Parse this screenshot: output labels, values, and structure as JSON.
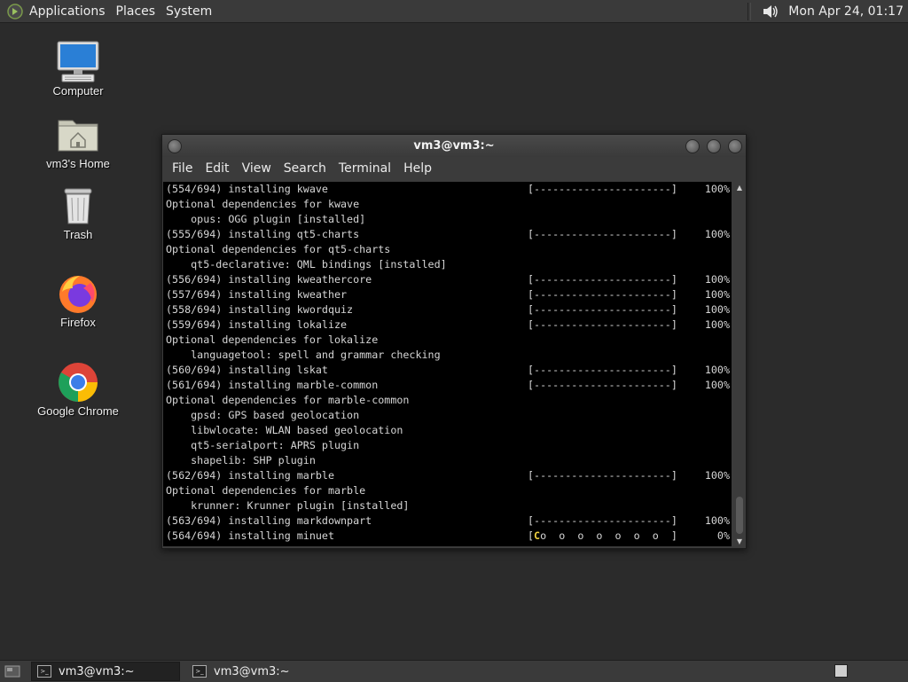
{
  "top_panel": {
    "menus": [
      "Applications",
      "Places",
      "System"
    ],
    "clock": "Mon Apr 24, 01:17"
  },
  "desktop_icons": [
    {
      "label": "Computer",
      "icon": "computer-icon"
    },
    {
      "label": "vm3's Home",
      "icon": "home-folder-icon"
    },
    {
      "label": "Trash",
      "icon": "trash-icon"
    },
    {
      "label": "Firefox",
      "icon": "firefox-icon"
    },
    {
      "label": "Google Chrome",
      "icon": "chrome-icon"
    }
  ],
  "window": {
    "title": "vm3@vm3:~",
    "menu": [
      "File",
      "Edit",
      "View",
      "Search",
      "Terminal",
      "Help"
    ]
  },
  "terminal": {
    "lines": [
      {
        "text": "(554/694) installing kwave",
        "bar": "[----------------------]",
        "pct": "100%"
      },
      {
        "text": "Optional dependencies for kwave"
      },
      {
        "text": "    opus: OGG plugin [installed]"
      },
      {
        "text": "(555/694) installing qt5-charts",
        "bar": "[----------------------]",
        "pct": "100%"
      },
      {
        "text": "Optional dependencies for qt5-charts"
      },
      {
        "text": "    qt5-declarative: QML bindings [installed]"
      },
      {
        "text": "(556/694) installing kweathercore",
        "bar": "[----------------------]",
        "pct": "100%"
      },
      {
        "text": "(557/694) installing kweather",
        "bar": "[----------------------]",
        "pct": "100%"
      },
      {
        "text": "(558/694) installing kwordquiz",
        "bar": "[----------------------]",
        "pct": "100%"
      },
      {
        "text": "(559/694) installing lokalize",
        "bar": "[----------------------]",
        "pct": "100%"
      },
      {
        "text": "Optional dependencies for lokalize"
      },
      {
        "text": "    languagetool: spell and grammar checking"
      },
      {
        "text": "(560/694) installing lskat",
        "bar": "[----------------------]",
        "pct": "100%"
      },
      {
        "text": "(561/694) installing marble-common",
        "bar": "[----------------------]",
        "pct": "100%"
      },
      {
        "text": "Optional dependencies for marble-common"
      },
      {
        "text": "    gpsd: GPS based geolocation"
      },
      {
        "text": "    libwlocate: WLAN based geolocation"
      },
      {
        "text": "    qt5-serialport: APRS plugin"
      },
      {
        "text": "    shapelib: SHP plugin"
      },
      {
        "text": "(562/694) installing marble",
        "bar": "[----------------------]",
        "pct": "100%"
      },
      {
        "text": "Optional dependencies for marble"
      },
      {
        "text": "    krunner: Krunner plugin [installed]"
      },
      {
        "text": "(563/694) installing markdownpart",
        "bar": "[----------------------]",
        "pct": "100%"
      },
      {
        "text": "(564/694) installing minuet",
        "bar_pac": "C",
        "bar": "o  o  o  o  o  o  o  ]",
        "pct": "0%"
      }
    ]
  },
  "taskbar": {
    "tasks": [
      {
        "label": "vm3@vm3:~",
        "active": true
      },
      {
        "label": "vm3@vm3:~",
        "active": false
      }
    ]
  }
}
